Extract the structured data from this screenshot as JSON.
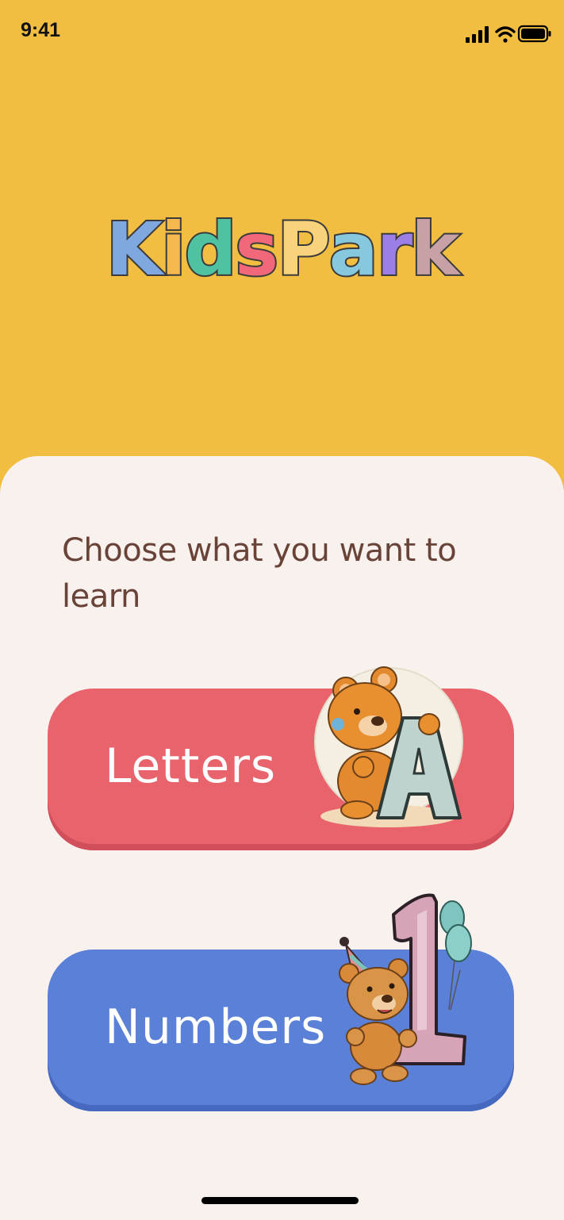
{
  "status_bar": {
    "time": "9:41",
    "icons": [
      "cellular-signal-icon",
      "wifi-icon",
      "battery-icon"
    ]
  },
  "logo": {
    "letters": [
      "K",
      "i",
      "d",
      "s",
      "P",
      "a",
      "r",
      "k"
    ],
    "colors": [
      "#7FA8E0",
      "#F5B84E",
      "#4FC3A1",
      "#F0687A",
      "#F9D37C",
      "#86C9DE",
      "#9B7FE6",
      "#C7A1A6"
    ]
  },
  "colors": {
    "header_background": "#F2BE42",
    "panel_background": "#F8F1EE",
    "prompt_text": "#6A4338",
    "letters_button": "#E8636C",
    "numbers_button": "#5A80D7"
  },
  "main": {
    "prompt": "Choose what you want to learn",
    "options": [
      {
        "label": "Letters",
        "illustration": "teddy-bear-letter-a-icon"
      },
      {
        "label": "Numbers",
        "illustration": "teddy-bear-number-one-balloons-icon"
      }
    ]
  }
}
